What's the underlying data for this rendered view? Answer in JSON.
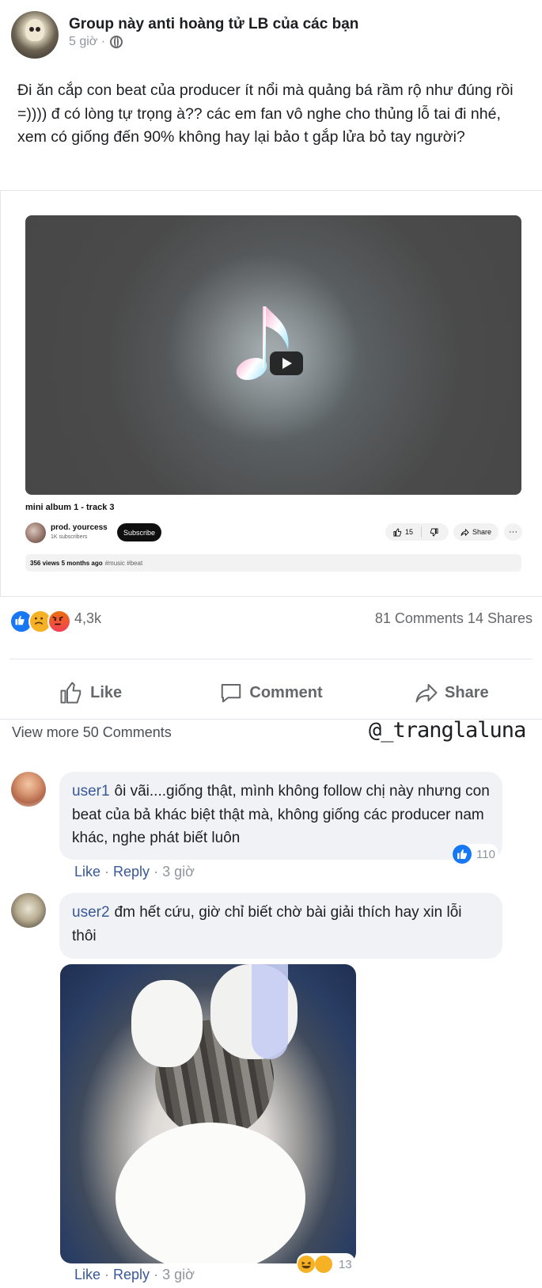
{
  "post": {
    "group_name": "Group này anti hoàng tử LB của các bạn",
    "time": "5 giờ ·",
    "privacy_icon": "globe-icon",
    "text": "Đi ăn cắp con beat của producer ít nổi mà quảng bá rầm rộ như đúng rồi =)))) đ có lòng tự trọng à?? các em fan vô nghe cho thủng lỗ tai đi nhé, xem có giống đến 90% không hay lại bảo t gắp lửa bỏ tay người?"
  },
  "video": {
    "title": "mini album 1 - track 3",
    "channel": "prod. yourcess",
    "subscribers": "1K subscribers",
    "subscribe_label": "Subscribe",
    "likes": "15",
    "share_label": "Share",
    "more_label": "···",
    "views_line": "356 views  5 months ago",
    "tags": "#music #beat"
  },
  "reactions": {
    "count": "4,3k",
    "comments_shares": "81 Comments 14 Shares"
  },
  "actions": {
    "like": "Like",
    "comment": "Comment",
    "share": "Share"
  },
  "view_more": "View more 50 Comments",
  "watermark": "@_tranglaluna",
  "comments": [
    {
      "user": "user1",
      "text": "ôi vãi....giống thật, mình không follow chị này nhưng con beat của bả khác biệt thật mà, không giống các producer nam khác, nghe phát biết luôn",
      "like": "Like",
      "reply": "Reply",
      "time": "3 giờ",
      "reaction_count": "110"
    },
    {
      "user": "user2",
      "text": "đm hết cứu, giờ chỉ biết chờ bài giải thích hay xin lỗi thôi",
      "like": "Like",
      "reply": "Reply",
      "time": "3 giờ",
      "reaction_count": "13"
    }
  ],
  "colors": {
    "link": "#385898",
    "muted": "#65676b",
    "facebook_blue": "#1877f2",
    "bubble_bg": "#f0f2f5"
  }
}
